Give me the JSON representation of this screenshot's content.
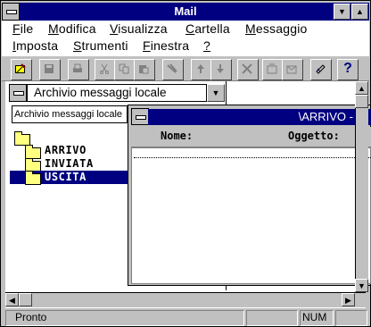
{
  "window": {
    "title": "Mail"
  },
  "menu": {
    "row1": [
      "File",
      "Modifica",
      "Visualizza",
      "Cartella",
      "Messaggio"
    ],
    "row2": [
      "Imposta",
      "Strumenti",
      "Finestra",
      "?"
    ]
  },
  "toolbar": {
    "icons": [
      "compose-icon",
      "save-icon",
      "print-icon",
      "cut-icon",
      "copy-icon",
      "paste-icon",
      "delete-icon",
      "move-up-icon",
      "move-down-icon",
      "cancel-icon",
      "forward-icon",
      "reply-icon",
      "address-book-icon",
      "help-icon"
    ],
    "help_label": "?"
  },
  "folder_panel": {
    "combo_value": "Archivio messaggi locale",
    "field_value": "Archivio messaggi locale",
    "tree": [
      {
        "label": "",
        "icon": "folder-icon"
      },
      {
        "label": "ARRIVO",
        "icon": "open-folder-icon"
      },
      {
        "label": "INVIATA",
        "icon": "folder-icon"
      },
      {
        "label": "USCITA",
        "icon": "folder-icon",
        "selected": true
      }
    ]
  },
  "message_window": {
    "title": "\\ARRIVO -",
    "columns": [
      "Nome:",
      "Oggetto:"
    ]
  },
  "status": {
    "text": "Pronto",
    "num": "NUM"
  },
  "colors": {
    "titlebar": "#000080",
    "face": "#c0c0c0",
    "selection": "#000080",
    "folder": "#ffff80"
  }
}
